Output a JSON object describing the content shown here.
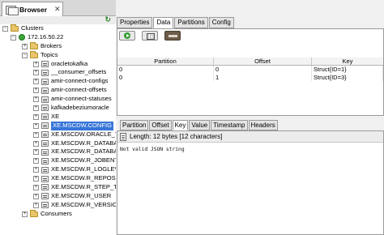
{
  "browser": {
    "tab_label": "Browser",
    "tab_close": "✕",
    "collapse_icon": "↻"
  },
  "tree": {
    "clusters_label": "Clusters",
    "server_label": "172.16.50.22",
    "brokers_label": "Brokers",
    "topics_label": "Topics",
    "topics": [
      "oracletokafka",
      "__consumer_offsets",
      "amir-connect-configs",
      "amir-connect-offsets",
      "amir-connect-statuses",
      "kafkadebeziumoracle",
      "XE",
      "XE.MSCDW.CONFIG",
      "XE.MSCDW.ORACLE_TC",
      "XE.MSCDW.R_DATABAS",
      "XE.MSCDW.R_DATABAS",
      "XE.MSCDW.R_JOBENT",
      "XE.MSCDW.R_LOGLEVE",
      "XE.MSCDW.R_REPOSIT",
      "XE.MSCDW.R_STEP_TYI",
      "XE.MSCDW.R_USER",
      "XE.MSCDW.R_VERSION"
    ],
    "selected_topic": "XE.MSCDW.CONFIG",
    "consumers_label": "Consumers"
  },
  "top_tabs": [
    "Properties",
    "Data",
    "Partitions",
    "Config"
  ],
  "top_active_tab": "Data",
  "table": {
    "headers": [
      "Partition",
      "Offset",
      "Key"
    ],
    "rows": [
      [
        "0",
        "0",
        "Struct{ID=1}"
      ],
      [
        "0",
        "1",
        "Struct{ID=3}"
      ]
    ]
  },
  "bottom_tabs": [
    "Partition",
    "Offset",
    "Key",
    "Value",
    "Timestamp",
    "Headers"
  ],
  "bottom_active_tab": "Key",
  "detail": {
    "length_text": "Length: 12 bytes [12 characters]",
    "content": "Not valid JSON string"
  },
  "colors": {
    "selection": "#3776d8",
    "run_button": "#2f9a2f"
  }
}
